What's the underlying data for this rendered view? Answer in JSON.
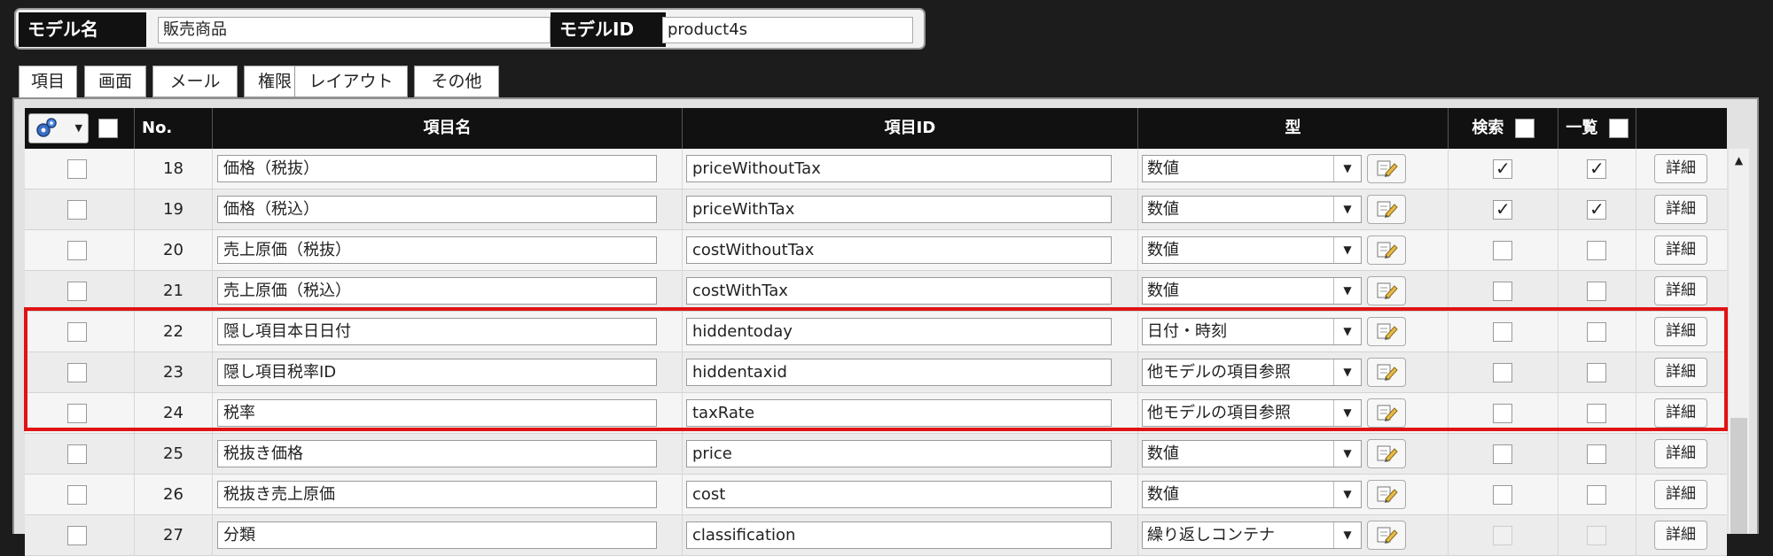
{
  "header": {
    "model_name_label": "モデル名",
    "model_name_value": "販売商品",
    "model_id_label": "モデルID",
    "model_id_value": "product4s"
  },
  "tabs": [
    {
      "label": "項目",
      "active": true
    },
    {
      "label": "画面",
      "active": false
    },
    {
      "label": "メール",
      "active": false
    },
    {
      "label": "権限",
      "active": false
    },
    {
      "label": "レイアウト",
      "active": false
    },
    {
      "label": "その他",
      "active": false
    }
  ],
  "table": {
    "columns": {
      "no": "No.",
      "name": "項目名",
      "id": "項目ID",
      "type": "型",
      "search": "検索",
      "list": "一覧"
    },
    "detail_label": "詳細",
    "rows": [
      {
        "no": "18",
        "name": "価格（税抜）",
        "id": "priceWithoutTax",
        "type": "数値",
        "search": true,
        "list": true,
        "highlighted": false
      },
      {
        "no": "19",
        "name": "価格（税込）",
        "id": "priceWithTax",
        "type": "数値",
        "search": true,
        "list": true,
        "highlighted": false
      },
      {
        "no": "20",
        "name": "売上原価（税抜）",
        "id": "costWithoutTax",
        "type": "数値",
        "search": false,
        "list": false,
        "highlighted": false
      },
      {
        "no": "21",
        "name": "売上原価（税込）",
        "id": "costWithTax",
        "type": "数値",
        "search": false,
        "list": false,
        "highlighted": false
      },
      {
        "no": "22",
        "name": "隠し項目本日日付",
        "id": "hiddentoday",
        "type": "日付・時刻",
        "search": false,
        "list": false,
        "highlighted": true
      },
      {
        "no": "23",
        "name": "隠し項目税率ID",
        "id": "hiddentaxid",
        "type": "他モデルの項目参照",
        "search": false,
        "list": false,
        "highlighted": true
      },
      {
        "no": "24",
        "name": "税率",
        "id": "taxRate",
        "type": "他モデルの項目参照",
        "search": false,
        "list": false,
        "highlighted": true
      },
      {
        "no": "25",
        "name": "税抜き価格",
        "id": "price",
        "type": "数値",
        "search": false,
        "list": false,
        "highlighted": false
      },
      {
        "no": "26",
        "name": "税抜き売上原価",
        "id": "cost",
        "type": "数値",
        "search": false,
        "list": false,
        "highlighted": false
      },
      {
        "no": "27",
        "name": "分類",
        "id": "classification",
        "type": "繰り返しコンテナ",
        "search": false,
        "list": false,
        "highlighted": false
      }
    ]
  },
  "colors": {
    "highlight_border": "#e01313",
    "header_bg": "#111111",
    "page_bg": "#1c1c1c"
  }
}
